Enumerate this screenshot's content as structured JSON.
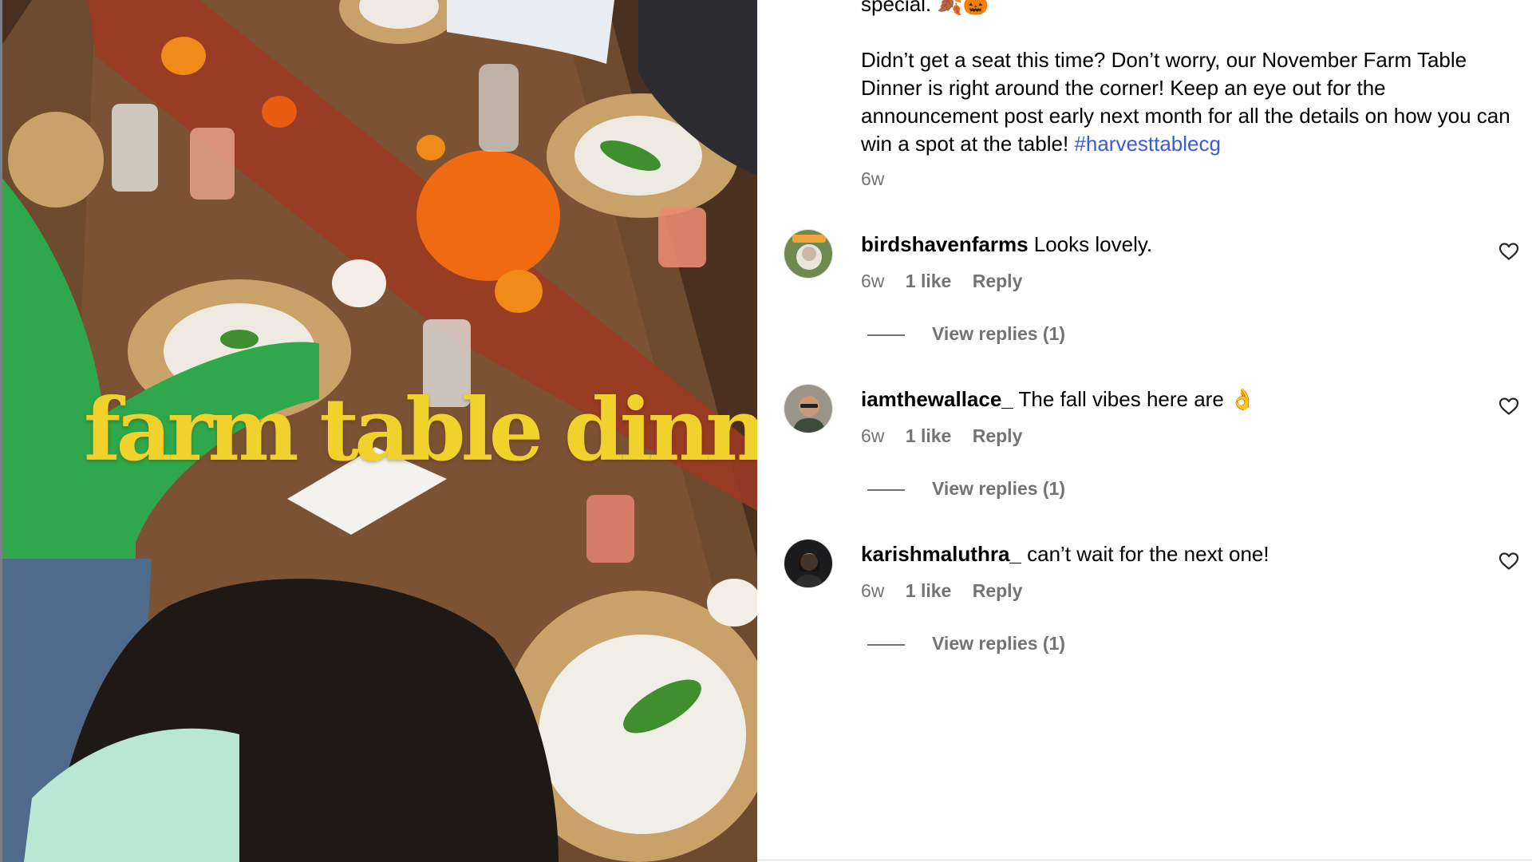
{
  "media": {
    "overlay_title": "farm table dinner"
  },
  "post": {
    "caption_line0": "special. 🍂🎃",
    "caption_body": "Didn’t get a seat this time? Don’t worry, our November Farm Table Dinner is right around the corner! Keep an eye out for the announcement post early next month for all the details on how you can win a spot at the table!",
    "hashtag": "#harvesttablecg",
    "time": "6w"
  },
  "comments": [
    {
      "username": "birdshavenfarms",
      "text": "Looks lovely.",
      "time": "6w",
      "likes": "1 like",
      "reply_label": "Reply",
      "view_replies": "View replies (1)"
    },
    {
      "username": "iamthewallace_",
      "text": "The fall vibes here are 👌",
      "time": "6w",
      "likes": "1 like",
      "reply_label": "Reply",
      "view_replies": "View replies (1)"
    },
    {
      "username": "karishmaluthra_",
      "text": "can’t wait for the next one!",
      "time": "6w",
      "likes": "1 like",
      "reply_label": "Reply",
      "view_replies": "View replies (1)"
    }
  ],
  "icons": {
    "like": "heart-icon"
  },
  "colors": {
    "hashtag": "#3b5bdb",
    "overlay_title": "#f1d22c",
    "meta_text": "#737373"
  }
}
